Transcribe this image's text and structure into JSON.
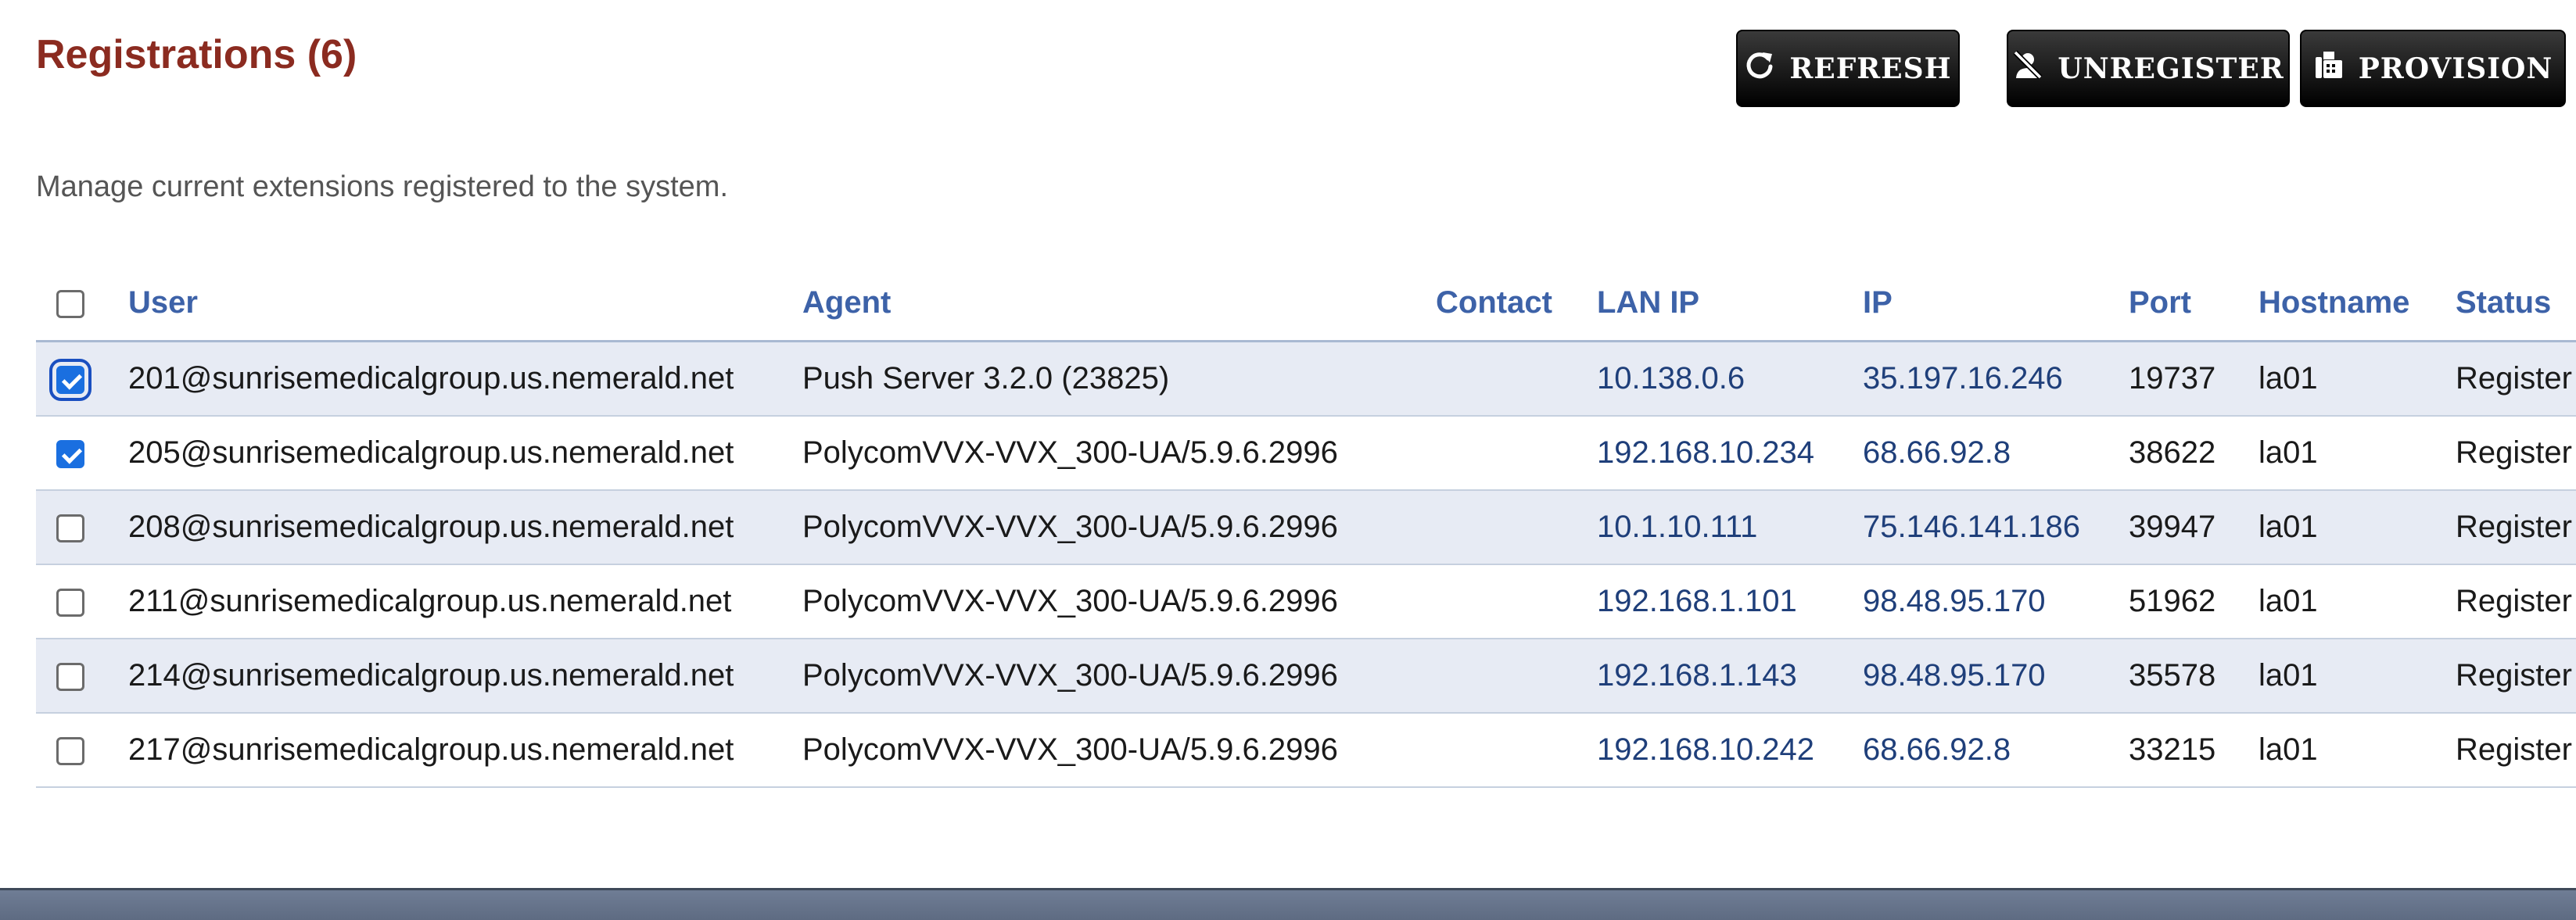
{
  "page": {
    "title": "Registrations (6)",
    "subtitle": "Manage current extensions registered to the system."
  },
  "toolbar": {
    "refresh_label": "REFRESH",
    "unregister_label": "UNREGISTER",
    "provision_label": "PROVISION"
  },
  "table": {
    "headers": {
      "user": "User",
      "agent": "Agent",
      "contact": "Contact",
      "lan_ip": "LAN IP",
      "ip": "IP",
      "port": "Port",
      "hostname": "Hostname",
      "status": "Status"
    },
    "rows": [
      {
        "checked": true,
        "focused": true,
        "user": "201@sunrisemedicalgroup.us.nemerald.net",
        "agent": "Push Server 3.2.0 (23825)",
        "contact": "",
        "lan_ip": "10.138.0.6",
        "ip": "35.197.16.246",
        "port": "19737",
        "hostname": "la01",
        "status": "Register"
      },
      {
        "checked": true,
        "focused": false,
        "user": "205@sunrisemedicalgroup.us.nemerald.net",
        "agent": "PolycomVVX-VVX_300-UA/5.9.6.2996",
        "contact": "",
        "lan_ip": "192.168.10.234",
        "ip": "68.66.92.8",
        "port": "38622",
        "hostname": "la01",
        "status": "Register"
      },
      {
        "checked": false,
        "focused": false,
        "user": "208@sunrisemedicalgroup.us.nemerald.net",
        "agent": "PolycomVVX-VVX_300-UA/5.9.6.2996",
        "contact": "",
        "lan_ip": "10.1.10.111",
        "ip": "75.146.141.186",
        "port": "39947",
        "hostname": "la01",
        "status": "Register"
      },
      {
        "checked": false,
        "focused": false,
        "user": "211@sunrisemedicalgroup.us.nemerald.net",
        "agent": "PolycomVVX-VVX_300-UA/5.9.6.2996",
        "contact": "",
        "lan_ip": "192.168.1.101",
        "ip": "98.48.95.170",
        "port": "51962",
        "hostname": "la01",
        "status": "Register"
      },
      {
        "checked": false,
        "focused": false,
        "user": "214@sunrisemedicalgroup.us.nemerald.net",
        "agent": "PolycomVVX-VVX_300-UA/5.9.6.2996",
        "contact": "",
        "lan_ip": "192.168.1.143",
        "ip": "98.48.95.170",
        "port": "35578",
        "hostname": "la01",
        "status": "Register"
      },
      {
        "checked": false,
        "focused": false,
        "user": "217@sunrisemedicalgroup.us.nemerald.net",
        "agent": "PolycomVVX-VVX_300-UA/5.9.6.2996",
        "contact": "",
        "lan_ip": "192.168.10.242",
        "ip": "68.66.92.8",
        "port": "33215",
        "hostname": "la01",
        "status": "Register"
      }
    ]
  },
  "icons": {
    "refresh": "refresh-icon",
    "unregister": "user-slash-icon",
    "provision": "fax-icon"
  },
  "colors": {
    "title": "#8b2b20",
    "header_text": "#3d62a8",
    "link_text": "#1f3f7a",
    "row_stripe": "#e7ebf4",
    "button_bg": "#000000",
    "checkbox_checked": "#1a6fe0"
  }
}
